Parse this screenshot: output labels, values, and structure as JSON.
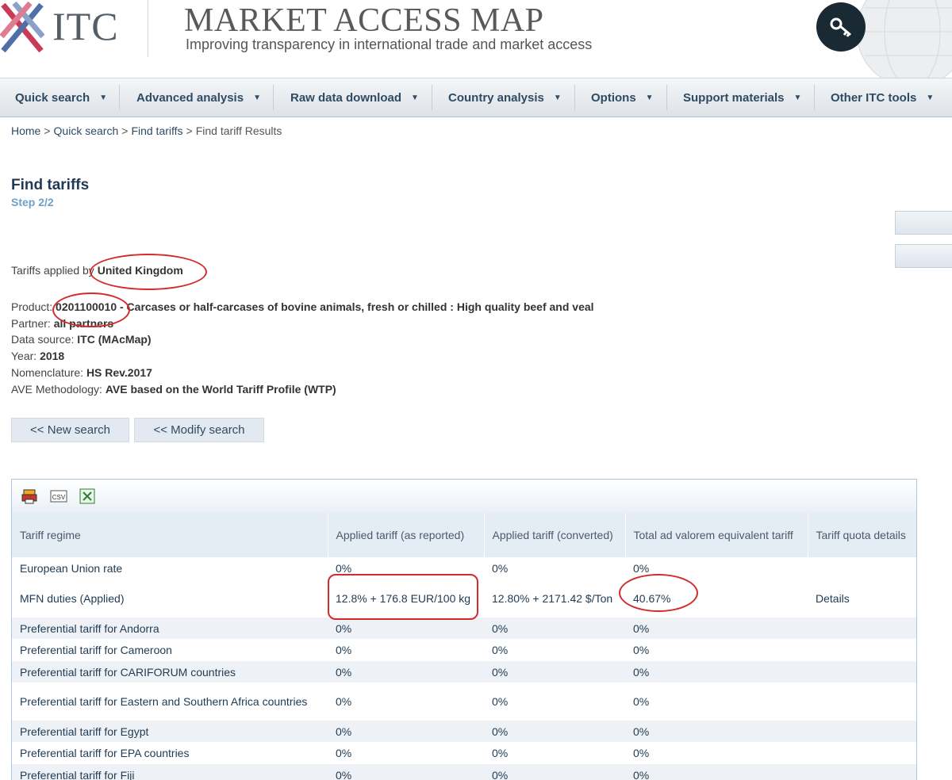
{
  "header": {
    "logo_text": "ITC",
    "brand_title": "MARKET ACCESS MAP",
    "brand_subtitle": "Improving transparency in international trade and market access"
  },
  "nav": [
    {
      "label": "Quick search"
    },
    {
      "label": "Advanced analysis"
    },
    {
      "label": "Raw data download"
    },
    {
      "label": "Country analysis"
    },
    {
      "label": "Options"
    },
    {
      "label": "Support materials"
    },
    {
      "label": "Other ITC tools"
    }
  ],
  "breadcrumb": [
    "Home",
    "Quick search",
    "Find tariffs",
    "Find tariff Results"
  ],
  "page": {
    "title": "Find tariffs",
    "step": "Step 2/2"
  },
  "info": {
    "applied_by_label": "Tariffs applied by ",
    "applied_by_value": "United Kingdom",
    "product_label": "Product: ",
    "product_value": "0201100010 - Carcases or half-carcases of bovine animals, fresh or chilled : High quality beef and veal",
    "partner_label": "Partner: ",
    "partner_value": "all partners",
    "source_label": "Data source: ",
    "source_value": "ITC (MAcMap)",
    "year_label": "Year: ",
    "year_value": "2018",
    "nomenclature_label": "Nomenclature: ",
    "nomenclature_value": "HS Rev.2017",
    "ave_label": "AVE Methodology: ",
    "ave_value": "AVE based on the World Tariff Profile (WTP)"
  },
  "buttons": {
    "new_search": "<< New search",
    "modify_search": "<< Modify search"
  },
  "table": {
    "headers": [
      "Tariff regime",
      "Applied tariff (as reported)",
      "Applied tariff (converted)",
      "Total ad valorem equivalent tariff",
      "Tariff quota details"
    ],
    "rows": [
      {
        "regime": "European Union rate",
        "reported": "0%",
        "converted": "0%",
        "ave": "0%",
        "quota": ""
      },
      {
        "regime": "MFN duties (Applied)",
        "reported": "12.8% + 176.8 EUR/100 kg",
        "converted": "12.80% + 2171.42 $/Ton",
        "ave": "40.67%",
        "quota": "Details"
      },
      {
        "regime": "Preferential tariff for Andorra",
        "reported": "0%",
        "converted": "0%",
        "ave": "0%",
        "quota": ""
      },
      {
        "regime": "Preferential tariff for Cameroon",
        "reported": "0%",
        "converted": "0%",
        "ave": "0%",
        "quota": ""
      },
      {
        "regime": "Preferential tariff for CARIFORUM countries",
        "reported": "0%",
        "converted": "0%",
        "ave": "0%",
        "quota": ""
      },
      {
        "regime": "Preferential tariff for Eastern and Southern Africa countries",
        "reported": "0%",
        "converted": "0%",
        "ave": "0%",
        "quota": ""
      },
      {
        "regime": "Preferential tariff for Egypt",
        "reported": "0%",
        "converted": "0%",
        "ave": "0%",
        "quota": ""
      },
      {
        "regime": "Preferential tariff for EPA countries",
        "reported": "0%",
        "converted": "0%",
        "ave": "0%",
        "quota": ""
      },
      {
        "regime": "Preferential tariff for Fiji",
        "reported": "0%",
        "converted": "0%",
        "ave": "0%",
        "quota": ""
      }
    ]
  },
  "toolbar": {
    "csv_label": "CSV"
  },
  "colors": {
    "annotation_red": "#d42a2a",
    "nav_text": "#2f4a63",
    "title": "#1f3a52"
  }
}
